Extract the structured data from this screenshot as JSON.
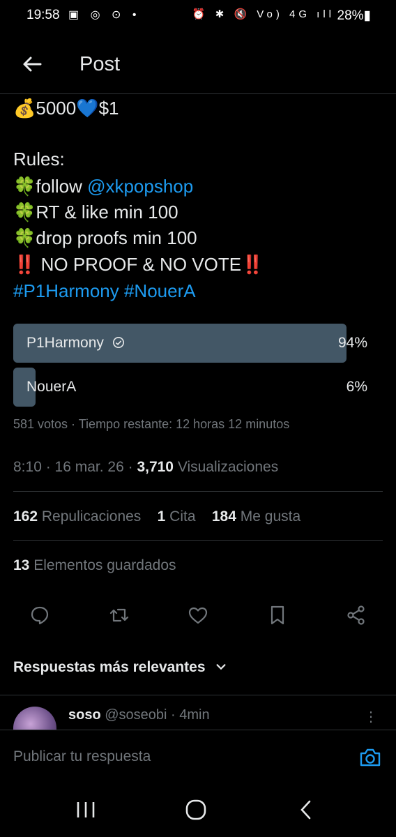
{
  "status_bar": {
    "time": "19:58",
    "left_icons": "▣ ◎ ⊙ •",
    "right_icons": "⏰ ✱ 🔇 Vo) 4G ıll",
    "battery": "28%▮"
  },
  "header": {
    "title": "Post"
  },
  "tweet": {
    "line1": "💰5000💙$1",
    "line2": "Rules:",
    "line3_prefix": "🍀follow ",
    "line3_handle": "@xkpopshop",
    "line4": "🍀RT & like min 100",
    "line5": "🍀drop proofs min 100",
    "line6_a": "‼️",
    "line6_b": " NO PROOF & NO VOTE",
    "line6_c": "‼️",
    "hashtags": "#P1Harmony #NouerA"
  },
  "poll": {
    "options": [
      {
        "label": "P1Harmony",
        "percent": "94%",
        "share": 0.94,
        "chosen": true
      },
      {
        "label": "NouerA",
        "percent": "6%",
        "share": 0.06,
        "chosen": false
      }
    ],
    "summary": "581 votos · Tiempo restante: 12 horas 12 minutos"
  },
  "meta": {
    "time_date": "8:10 · 16 mar. 26 · ",
    "views_count": "3,710",
    "views_label": " Visualizaciones"
  },
  "stats": {
    "reposts_count": "162",
    "reposts_label": " Repulicaciones",
    "quotes_count": "1",
    "quotes_label": " Cita",
    "likes_count": "184",
    "likes_label": " Me gusta",
    "bookmarks_count": "13",
    "bookmarks_label": " Elementos guardados"
  },
  "relevant_label": "Respuestas más relevantes",
  "reply": {
    "name": "soso",
    "handle_time": " @soseobi · 4min"
  },
  "compose": {
    "placeholder": "Publicar tu respuesta"
  }
}
